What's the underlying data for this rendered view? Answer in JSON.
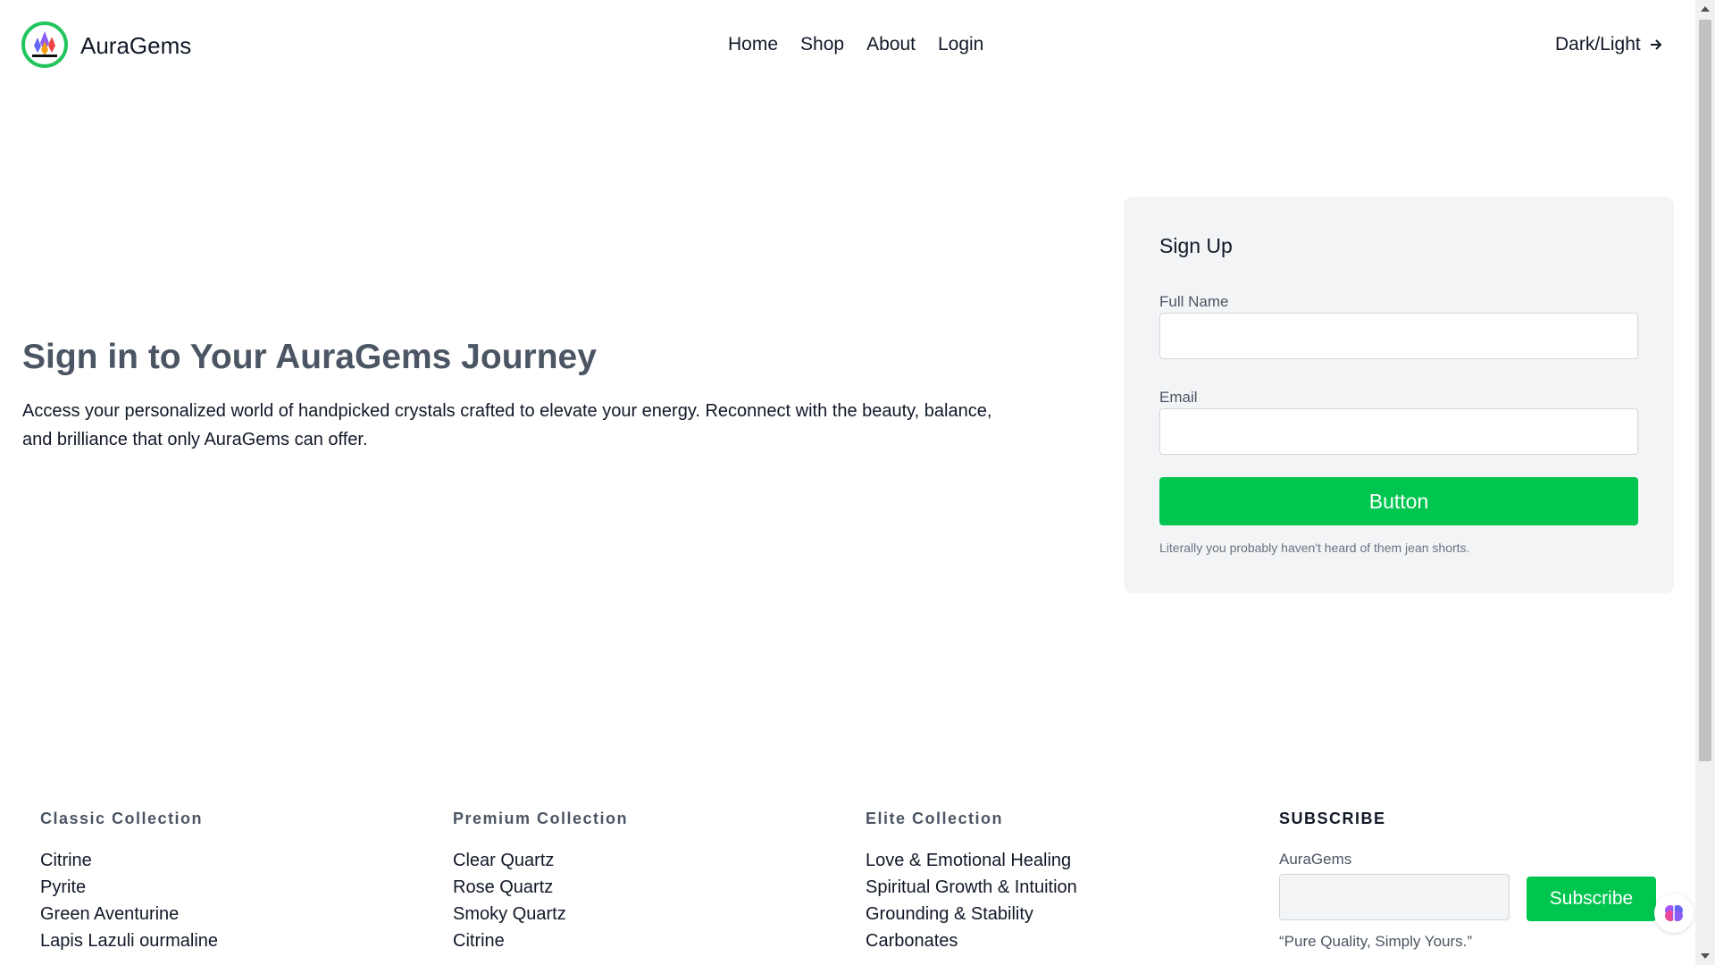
{
  "header": {
    "brand": "AuraGems",
    "logo_icon": "crystal-logo-icon",
    "nav": [
      "Home",
      "Shop",
      "About",
      "Login"
    ],
    "theme_toggle": "Dark/Light",
    "theme_toggle_icon": "arrow-right-icon"
  },
  "hero": {
    "title": "Sign in to Your AuraGems Journey",
    "text": "Access your personalized world of handpicked crystals crafted to elevate your energy. Reconnect with the beauty, balance, and brilliance that only AuraGems can offer."
  },
  "signup": {
    "title": "Sign Up",
    "fields": [
      {
        "label": "Full Name",
        "value": ""
      },
      {
        "label": "Email",
        "value": ""
      }
    ],
    "button": "Button",
    "note": "Literally you probably haven't heard of them jean shorts."
  },
  "footer": {
    "columns": [
      {
        "heading": "Classic Collection",
        "items": [
          "Citrine",
          "Pyrite",
          "Green Aventurine",
          "Lapis Lazuli ourmaline"
        ]
      },
      {
        "heading": "Premium Collection",
        "items": [
          "Clear Quartz",
          "Rose Quartz",
          "Smoky Quartz",
          "Citrine"
        ]
      },
      {
        "heading": "Elite Collection",
        "items": [
          "Love & Emotional Healing",
          "Spiritual Growth & Intuition",
          "Grounding & Stability",
          "Carbonates"
        ]
      }
    ],
    "subscribe": {
      "heading": "SUBSCRIBE",
      "label": "AuraGems",
      "input_value": "",
      "button": "Subscribe",
      "tagline": "“Pure Quality, Simply Yours.”"
    }
  },
  "colors": {
    "accent_green": "#00c54f",
    "logo_ring": "#22c55e",
    "card_bg": "#f3f4f6",
    "heading_gray": "#4b5563"
  },
  "floating_icon": "brain-icon"
}
